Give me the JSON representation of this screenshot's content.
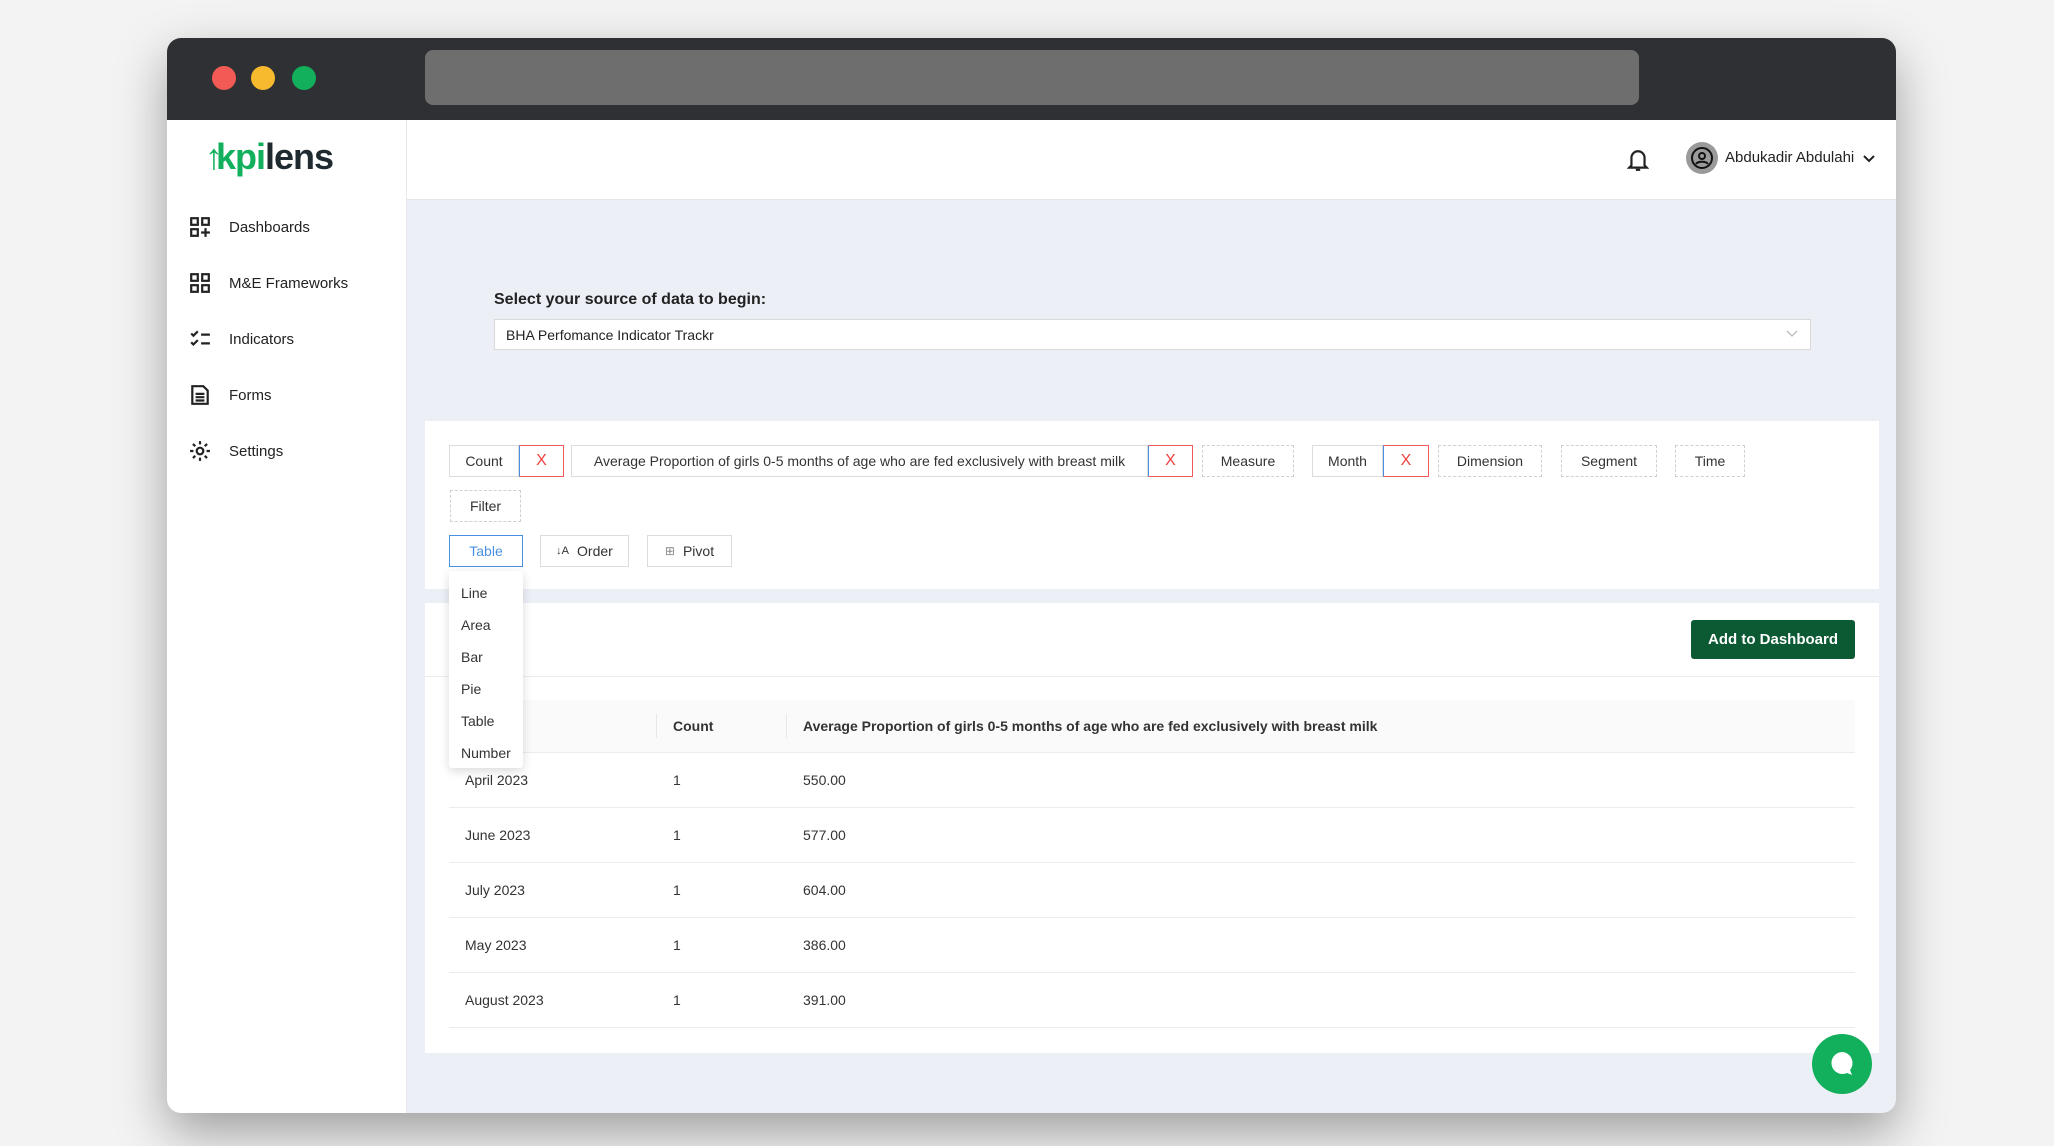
{
  "app": {
    "logo": "kpilens",
    "user_name": "Abdukadir Abdulahi"
  },
  "sidebar": {
    "items": [
      {
        "label": "Dashboards",
        "icon": "dashboard-add-icon"
      },
      {
        "label": "M&E Frameworks",
        "icon": "grid-icon"
      },
      {
        "label": "Indicators",
        "icon": "checklist-icon"
      },
      {
        "label": "Forms",
        "icon": "document-icon"
      },
      {
        "label": "Settings",
        "icon": "gear-icon"
      }
    ]
  },
  "source": {
    "label": "Select your source of data to begin:",
    "value": "BHA Perfomance Indicator Trackr"
  },
  "query": {
    "measures": [
      "Count",
      "Average Proportion of girls 0-5 months of age who are fed exclusively with breast milk"
    ],
    "measure_btn": "Measure",
    "dimensions": [
      "Month"
    ],
    "dimension_btn": "Dimension",
    "segment_btn": "Segment",
    "time_btn": "Time",
    "filter_btn": "Filter",
    "remove_icon": "X"
  },
  "toolbar": {
    "chart_type": "Table",
    "order": "Order",
    "pivot": "Pivot"
  },
  "chart_menu": [
    "Line",
    "Area",
    "Bar",
    "Pie",
    "Table",
    "Number"
  ],
  "results": {
    "add_button": "Add to Dashboard",
    "columns": [
      "",
      "Count",
      "Average Proportion of girls 0-5 months of age who are fed exclusively with breast milk"
    ],
    "rows": [
      [
        "April 2023",
        "1",
        "550.00"
      ],
      [
        "June 2023",
        "1",
        "577.00"
      ],
      [
        "July 2023",
        "1",
        "604.00"
      ],
      [
        "May 2023",
        "1",
        "386.00"
      ],
      [
        "August 2023",
        "1",
        "391.00"
      ]
    ]
  },
  "colors": {
    "brand": "#12b05c",
    "primary_dark": "#0b5a34",
    "danger": "#f04040",
    "active": "#4a90e2"
  }
}
